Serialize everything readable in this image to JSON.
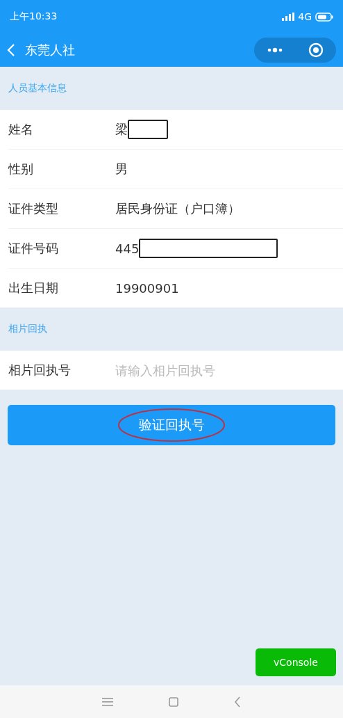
{
  "status_bar": {
    "time": "上午10:33",
    "network": "4G"
  },
  "nav_bar": {
    "title": "东莞人社"
  },
  "sections": [
    {
      "title": "人员基本信息",
      "kind": "info",
      "rows": [
        {
          "label": "姓名",
          "value": "梁",
          "redacted": true
        },
        {
          "label": "性别",
          "value": "男",
          "redacted": false
        },
        {
          "label": "证件类型",
          "value": "居民身份证（户口簿）",
          "redacted": false
        },
        {
          "label": "证件号码",
          "value": "445",
          "redacted": true
        },
        {
          "label": "出生日期",
          "value": "19900901",
          "redacted": false
        }
      ]
    },
    {
      "title": "相片回执",
      "kind": "input",
      "rows": [
        {
          "label": "相片回执号",
          "placeholder": "请输入相片回执号"
        }
      ]
    }
  ],
  "submit_button": {
    "label": "验证回执号",
    "annotated": true
  },
  "vconsole_button": {
    "label": "vConsole"
  }
}
